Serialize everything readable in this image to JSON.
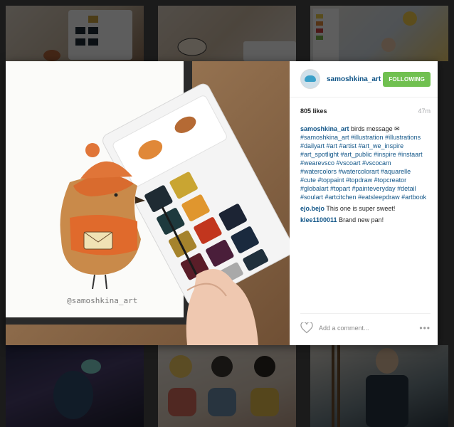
{
  "post": {
    "username": "samoshkina_art",
    "follow_label": "FOLLOWING",
    "likes": "805 likes",
    "time": "47m",
    "caption_user": "samoshkina_art",
    "caption_text": " birds message ✉",
    "caption_tags": "#samoshkina_art #illustration #illustrations #dailyart #art #artist #art_we_inspire #art_spotlight #art_public #inspire #instaart #wearevsco #vscoart #vscocam #watercolors #watercolorart #aquarelle #cute #toppaint #topdraw #topcreator #globalart #topart #painteveryday #detail #soulart #artcitchen #eatsleepdraw #artbook",
    "comments": [
      {
        "user": "ejo.bejo",
        "text": " This one is super sweet!"
      },
      {
        "user": "klee1100011",
        "text": " Brand new pan!"
      }
    ],
    "add_comment_placeholder": "Add a comment...",
    "more_label": "•••",
    "photo_signature": "@samoshkina_art"
  },
  "icons": {
    "like": "heart-icon",
    "more": "more-options-icon",
    "avatar": "avatar"
  },
  "colors": {
    "link": "#125688",
    "follow": "#70c050",
    "muted": "#a5a7aa"
  }
}
